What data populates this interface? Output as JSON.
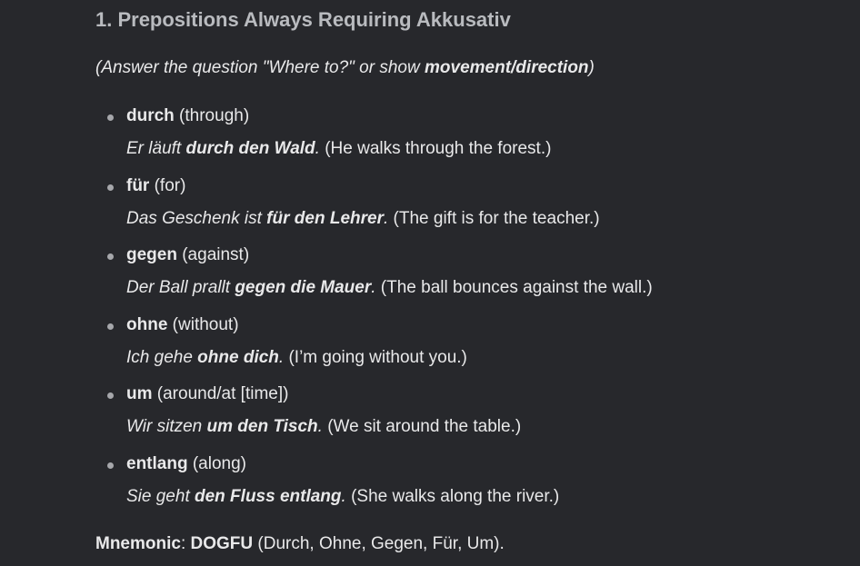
{
  "heading": "1. Prepositions Always Requiring Akkusativ",
  "intro": {
    "prefix": "(Answer the question \"Where to?\" or show ",
    "bold": "movement/direction",
    "suffix": ")"
  },
  "items": [
    {
      "term": "durch",
      "meaning": " (through)",
      "example_pre": "Er läuft ",
      "example_bold": "durch den Wald",
      "example_post": ".",
      "translation": " (He walks through the forest.)"
    },
    {
      "term": "für",
      "meaning": " (for)",
      "example_pre": "Das Geschenk ist ",
      "example_bold": "für den Lehrer",
      "example_post": ".",
      "translation": " (The gift is for the teacher.)"
    },
    {
      "term": "gegen",
      "meaning": " (against)",
      "example_pre": "Der Ball prallt ",
      "example_bold": "gegen die Mauer",
      "example_post": ".",
      "translation": " (The ball bounces against the wall.)"
    },
    {
      "term": "ohne",
      "meaning": " (without)",
      "example_pre": "Ich gehe ",
      "example_bold": "ohne dich",
      "example_post": ".",
      "translation": " (I’m going without you.)"
    },
    {
      "term": "um",
      "meaning": " (around/at [time])",
      "example_pre": "Wir sitzen ",
      "example_bold": "um den Tisch",
      "example_post": ".",
      "translation": " (We sit around the table.)"
    },
    {
      "term": "entlang",
      "meaning": " (along)",
      "example_pre": "Sie geht ",
      "example_bold": "den Fluss entlang",
      "example_post": ".",
      "translation": " (She walks along the river.)"
    }
  ],
  "mnemonic": {
    "label": "Mnemonic",
    "colon": ": ",
    "code": "DOGFU",
    "expansion": " (Durch, Ohne, Gegen, Für, Um)."
  }
}
